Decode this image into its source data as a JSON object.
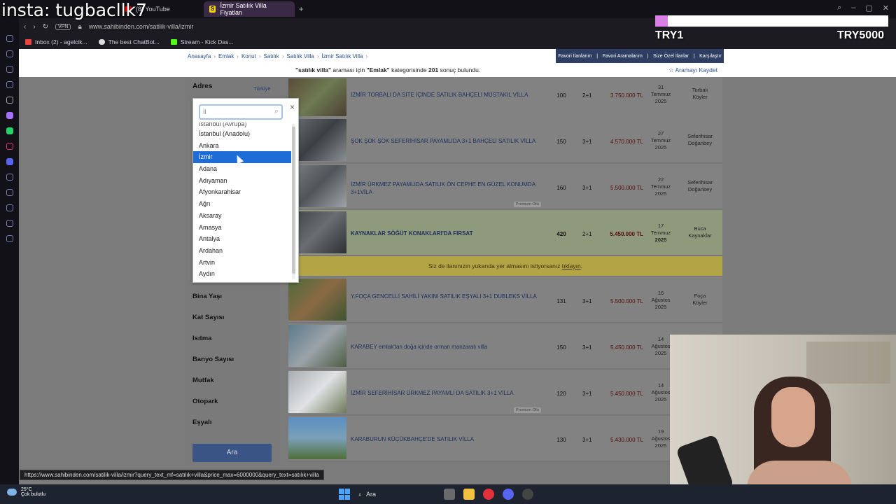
{
  "overlay": {
    "insta": "insta: tugbacllk7",
    "try_left": "TRY1",
    "try_right": "TRY5000"
  },
  "browser": {
    "tabs": [
      {
        "label": "(8) YouTube"
      },
      {
        "label": "İzmir Satılık Villa Fiyatları"
      }
    ],
    "active_tab_favicon": "S",
    "vpn_label": "VPN",
    "url": "www.sahibinden.com/satilik-villa/izmir",
    "bookmarks": [
      {
        "label": "Inbox (2) - agelcik..."
      },
      {
        "label": "The best ChatBot..."
      },
      {
        "label": "Stream - Kick Das..."
      }
    ]
  },
  "breadcrumbs": [
    "Anasayfa",
    "Emlak",
    "Konut",
    "Satılık",
    "Satılık Villa",
    "İzmir Satılık Villa"
  ],
  "top_links": [
    "Favori İlanlarım",
    "Favori Aramalarım",
    "Size Özel İlanlar",
    "Karşılaştır"
  ],
  "result": {
    "query": "\"satılık villa\"",
    "text_1": " araması için ",
    "category": "\"Emlak\"",
    "text_2": " kategorisinde ",
    "count": "201",
    "text_3": " sonuç bulundu.",
    "save_search": "☆ Aramayı Kaydet"
  },
  "filters": {
    "adres": "Adres",
    "turkiye": "Türkiye",
    "labels": [
      "Bina Yaşı",
      "Kat Sayısı",
      "Isıtma",
      "Banyo Sayısı",
      "Mutfak",
      "Otopark",
      "Eşyalı"
    ],
    "search_button": "Ara"
  },
  "popup": {
    "search_value": "İl",
    "close": "×",
    "partial_item": "İstanbul (Avrupa)",
    "items": [
      "İstanbul (Anadolu)",
      "Ankara",
      "İzmir",
      "Adana",
      "Adıyaman",
      "Afyonkarahisar",
      "Ağrı",
      "Aksaray",
      "Amasya",
      "Antalya",
      "Ardahan",
      "Artvin",
      "Aydın"
    ],
    "selected": "İzmir"
  },
  "listings": [
    {
      "title": "İZMİR TORBALI DA SİTE İÇİNDE SATILIK BAHÇELİ MÜSTAKİL VİLLA",
      "m2": "100",
      "rooms": "2+1",
      "price": "3.750.000 TL",
      "date": [
        "31",
        "Temmuz",
        "2025"
      ],
      "loc": [
        "Torbalı",
        "Köyler"
      ],
      "premium": ""
    },
    {
      "title": "ŞOK ŞOK ŞOK SEFERİHİSAR PAYAMLIDA 3+1 BAHÇELİ SATILIK VİLLA",
      "m2": "150",
      "rooms": "3+1",
      "price": "4.570.000 TL",
      "date": [
        "27",
        "Temmuz",
        "2025"
      ],
      "loc": [
        "Seferihisar",
        "Doğanbey"
      ],
      "premium": ""
    },
    {
      "title": "İZMİR ÜRKMEZ PAYAMLIDA SATILIK ÖN CEPHE EN GÜZEL KONUMDA 3+1VİLA",
      "m2": "160",
      "rooms": "3+1",
      "price": "5.500.000 TL",
      "date": [
        "22",
        "Temmuz",
        "2025"
      ],
      "loc": [
        "Seferihisar",
        "Doğanbey"
      ],
      "premium": "Premium Ofis"
    },
    {
      "title": "KAYNAKLAR SÖĞÜT KONAKLARI'DA FIRSAT",
      "m2": "420",
      "rooms": "2+1",
      "price": "5.450.000 TL",
      "date": [
        "17",
        "Temmuz",
        "2025"
      ],
      "loc": [
        "Buca",
        "Kaynaklar"
      ],
      "premium": ""
    },
    {
      "title": "Y.FOÇA GENCELLİ SAHİLİ YAKINI SATILIK EŞYALI 3+1 DUBLEKS VİLLA",
      "m2": "131",
      "rooms": "3+1",
      "price": "5.500.000 TL",
      "date": [
        "16",
        "Ağustos",
        "2025"
      ],
      "loc": [
        "Foça",
        "Köyler"
      ],
      "premium": ""
    },
    {
      "title": "KARABEY emlak'tan doğa içinde orman manzaralı villa",
      "m2": "150",
      "rooms": "3+1",
      "price": "5.450.000 TL",
      "date": [
        "14",
        "Ağustos",
        "2025"
      ],
      "loc": [
        "",
        ""
      ],
      "premium": ""
    },
    {
      "title": "İZMİR SEFERİHİSAR ÜRKMEZ PAYAMLI DA SATILIK 3+1 VİLLA",
      "m2": "120",
      "rooms": "3+1",
      "price": "5.450.000 TL",
      "date": [
        "14",
        "Ağustos",
        "2025"
      ],
      "loc": [
        "",
        ""
      ],
      "premium": "Premium Ofis"
    },
    {
      "title": "KARABURUN KÜÇÜKBAHÇE'DE SATILIK VİLLA",
      "m2": "130",
      "rooms": "3+1",
      "price": "5.430.000 TL",
      "date": [
        "19",
        "Ağustos",
        "2025"
      ],
      "loc": [
        "",
        ""
      ],
      "premium": ""
    }
  ],
  "promo": {
    "text": "Siz de ilanınızın yukarıda yer almasını istiyorsanız ",
    "link": "tıklayın",
    "end": "."
  },
  "status_url": "https://www.sahibinden.com/satilik-villa/izmir?query_text_mf=satılık+villa&price_max=6000000&query_text=satılık+villa",
  "taskbar": {
    "temp": "25°C",
    "weather": "Çok bulutlu",
    "search": "Ara"
  },
  "colors": {
    "accent": "#1e6cd8",
    "brand": "#ffd400",
    "nav": "#2e3e62"
  }
}
